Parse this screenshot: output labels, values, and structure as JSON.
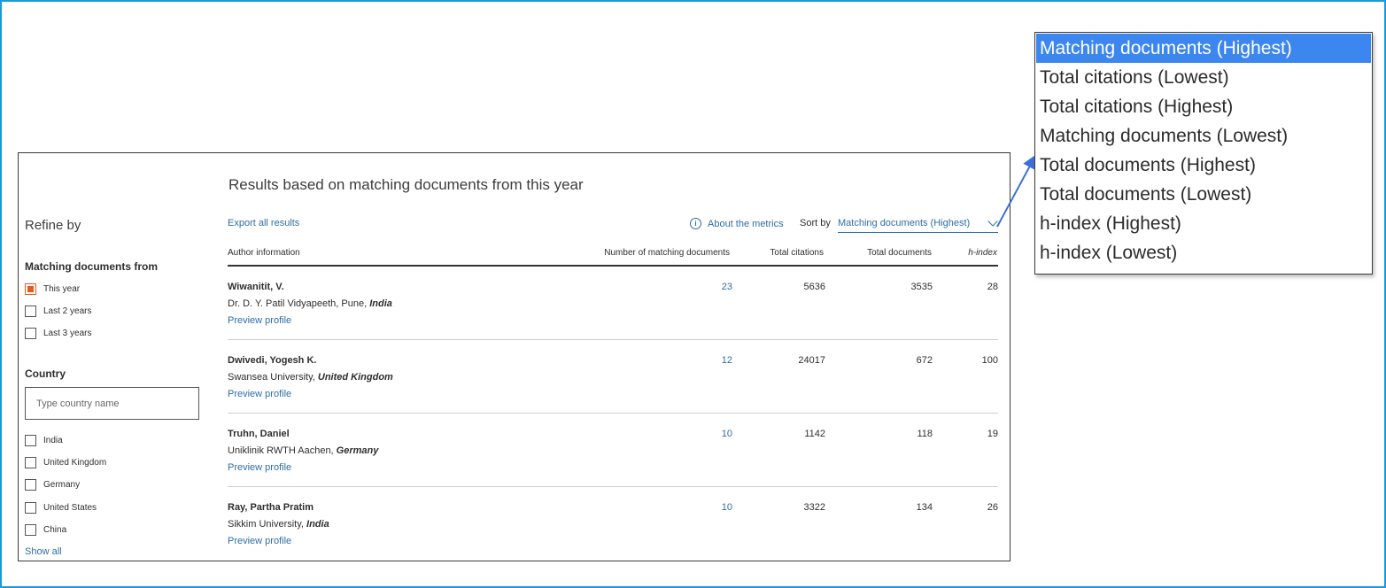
{
  "heading": "Results based on matching documents from this year",
  "sidebar": {
    "refine_title": "Refine by",
    "matching_title": "Matching documents from",
    "matching_options": [
      {
        "label": "This year",
        "checked": true
      },
      {
        "label": "Last 2 years",
        "checked": false
      },
      {
        "label": "Last 3 years",
        "checked": false
      }
    ],
    "country_title": "Country",
    "country_placeholder": "Type country name",
    "countries": [
      {
        "label": "India",
        "checked": false
      },
      {
        "label": "United Kingdom",
        "checked": false
      },
      {
        "label": "Germany",
        "checked": false
      },
      {
        "label": "United States",
        "checked": false
      },
      {
        "label": "China",
        "checked": false
      }
    ],
    "show_all": "Show all"
  },
  "toolbar": {
    "export": "Export all results",
    "about_icon": "info-icon",
    "about": "About the metrics",
    "sort_label": "Sort by",
    "sort_value": "Matching documents (Highest)"
  },
  "table": {
    "headers": [
      "Author information",
      "Number of matching documents",
      "Total citations",
      "Total documents",
      "h-index"
    ],
    "rows": [
      {
        "name": "Wiwanitit, V.",
        "affiliation": "Dr. D. Y. Patil Vidyapeeth, Pune, ",
        "country": "India",
        "preview": "Preview profile",
        "matching": "23",
        "citations": "5636",
        "documents": "3535",
        "hindex": "28"
      },
      {
        "name": "Dwivedi, Yogesh K.",
        "affiliation": "Swansea University, ",
        "country": "United Kingdom",
        "preview": "Preview profile",
        "matching": "12",
        "citations": "24017",
        "documents": "672",
        "hindex": "100"
      },
      {
        "name": "Truhn, Daniel",
        "affiliation": "Uniklinik RWTH Aachen, ",
        "country": "Germany",
        "preview": "Preview profile",
        "matching": "10",
        "citations": "1142",
        "documents": "118",
        "hindex": "19"
      },
      {
        "name": "Ray, Partha Pratim",
        "affiliation": "Sikkim University, ",
        "country": "India",
        "preview": "Preview profile",
        "matching": "10",
        "citations": "3322",
        "documents": "134",
        "hindex": "26"
      }
    ]
  },
  "dropdown": {
    "options": [
      "Matching documents (Highest)",
      "Total citations (Lowest)",
      "Total citations (Highest)",
      "Matching documents (Lowest)",
      "Total documents (Highest)",
      "Total documents (Lowest)",
      "h-index (Highest)",
      "h-index (Lowest)"
    ],
    "selected_index": 0
  },
  "colors": {
    "link": "#2e6da4",
    "checkbox_accent": "#e85a1c",
    "dropdown_highlight": "#3c86f0",
    "frame_border": "#1a9ad6"
  }
}
